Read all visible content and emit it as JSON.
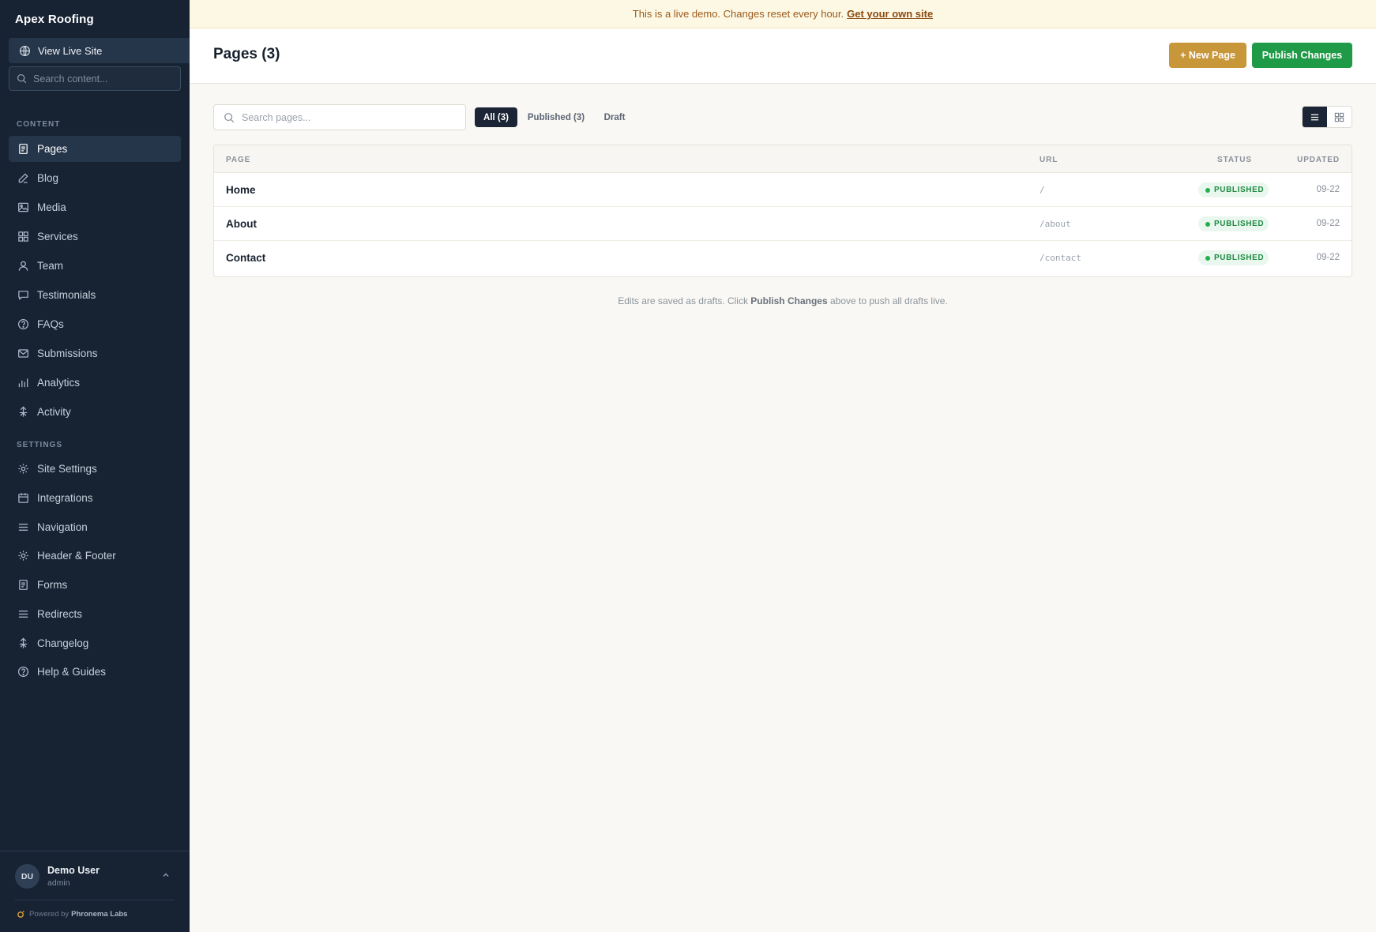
{
  "sidebar": {
    "brand": "Apex Roofing",
    "view_live_site": "View Live Site",
    "search_placeholder": "Search content...",
    "content_label": "CONTENT",
    "content_items": [
      {
        "label": "Pages",
        "icon": "page-icon",
        "active": true
      },
      {
        "label": "Blog",
        "icon": "pen-icon"
      },
      {
        "label": "Media",
        "icon": "image-icon"
      },
      {
        "label": "Services",
        "icon": "grid-icon"
      },
      {
        "label": "Team",
        "icon": "user-icon"
      },
      {
        "label": "Testimonials",
        "icon": "chat-icon"
      },
      {
        "label": "FAQs",
        "icon": "help-icon"
      },
      {
        "label": "Submissions",
        "icon": "mail-icon"
      },
      {
        "label": "Analytics",
        "icon": "bar-chart-icon"
      },
      {
        "label": "Activity",
        "icon": "activity-icon"
      }
    ],
    "settings_label": "SETTINGS",
    "settings_items": [
      {
        "label": "Site Settings",
        "icon": "gear-icon"
      },
      {
        "label": "Integrations",
        "icon": "calendar-icon"
      },
      {
        "label": "Navigation",
        "icon": "menu-icon"
      },
      {
        "label": "Header & Footer",
        "icon": "gear-icon"
      },
      {
        "label": "Forms",
        "icon": "page-icon"
      },
      {
        "label": "Redirects",
        "icon": "menu-icon"
      },
      {
        "label": "Changelog",
        "icon": "activity-icon"
      },
      {
        "label": "Help & Guides",
        "icon": "help-icon"
      }
    ],
    "user": {
      "initials": "DU",
      "name": "Demo User",
      "role": "admin"
    },
    "powered_prefix": "Powered by",
    "powered_brand": "Phronema Labs"
  },
  "banner": {
    "text": "This is a live demo. Changes reset every hour.",
    "link": "Get your own site"
  },
  "header": {
    "title": "Pages (3)",
    "new_page": "+ New Page",
    "publish": "Publish Changes"
  },
  "toolbar": {
    "search_placeholder": "Search pages...",
    "filters": [
      {
        "label": "All (3)",
        "active": true
      },
      {
        "label": "Published (3)"
      },
      {
        "label": "Draft"
      }
    ],
    "view_mode": "list"
  },
  "table": {
    "columns": {
      "page": "PAGE",
      "url": "URL",
      "status": "STATUS",
      "updated": "UPDATED"
    },
    "rows": [
      {
        "name": "Home",
        "url": "/",
        "status": "PUBLISHED",
        "updated": "09-22"
      },
      {
        "name": "About",
        "url": "/about",
        "status": "PUBLISHED",
        "updated": "09-22"
      },
      {
        "name": "Contact",
        "url": "/contact",
        "status": "PUBLISHED",
        "updated": "09-22"
      }
    ]
  },
  "hint": {
    "before": "Edits are saved as drafts. Click",
    "strong": "Publish Changes",
    "after": "above to push all drafts live."
  },
  "colors": {
    "sidebar_bg": "#172333",
    "accent_gold": "#c8973a",
    "publish_green": "#1f9a47",
    "status_green": "#22b04e"
  }
}
